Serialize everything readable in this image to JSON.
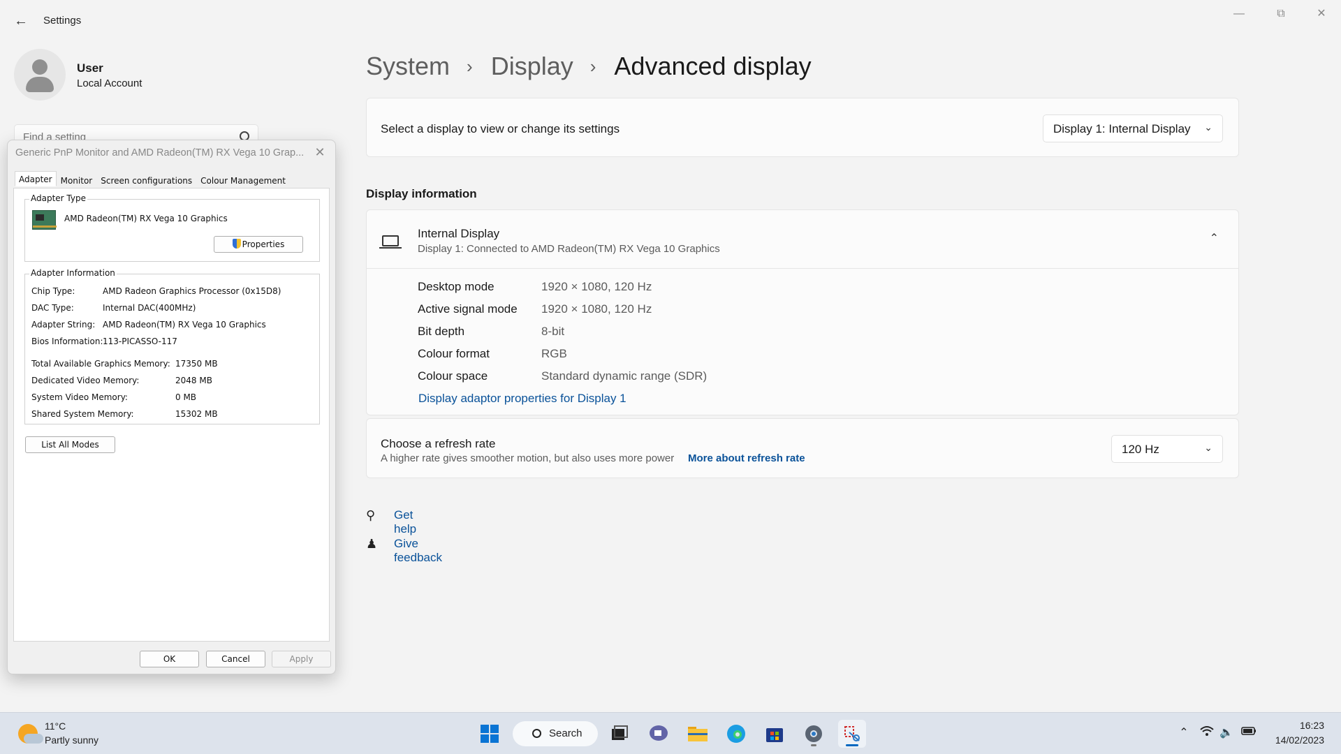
{
  "window": {
    "app_title": "Settings",
    "back_icon": "arrow-left-icon",
    "minimize_icon": "minimize-icon",
    "maximize_icon": "restore-icon",
    "close_icon": "close-icon"
  },
  "user": {
    "name": "User",
    "account_type": "Local Account"
  },
  "search": {
    "placeholder": "Find a setting"
  },
  "breadcrumb": [
    "System",
    "Display",
    "Advanced display"
  ],
  "display_select": {
    "label": "Select a display to view or change its settings",
    "selected": "Display 1: Internal Display"
  },
  "display_info": {
    "section_title": "Display information",
    "title": "Internal Display",
    "subtitle": "Display 1: Connected to AMD Radeon(TM) RX Vega 10 Graphics",
    "rows": [
      {
        "key": "Desktop mode",
        "value": "1920 × 1080, 120 Hz"
      },
      {
        "key": "Active signal mode",
        "value": "1920 × 1080, 120 Hz"
      },
      {
        "key": "Bit depth",
        "value": "8-bit"
      },
      {
        "key": "Colour format",
        "value": "RGB"
      },
      {
        "key": "Colour space",
        "value": "Standard dynamic range (SDR)"
      }
    ],
    "adaptor_link": "Display adaptor properties for Display 1"
  },
  "refresh": {
    "title": "Choose a refresh rate",
    "subtitle": "A higher rate gives smoother motion, but also uses more power",
    "more_link": "More about refresh rate",
    "selected": "120 Hz"
  },
  "help": {
    "get_help": "Get help",
    "give_feedback": "Give feedback"
  },
  "dialog": {
    "title": "Generic PnP Monitor and AMD Radeon(TM) RX Vega 10 Grap...",
    "tabs": [
      "Adapter",
      "Monitor",
      "Screen configurations",
      "Colour Management"
    ],
    "adapter_type_label": "Adapter Type",
    "adapter_name": "AMD Radeon(TM) RX Vega 10 Graphics",
    "properties_btn": "Properties",
    "adapter_info_label": "Adapter Information",
    "info": [
      {
        "key": "Chip Type:",
        "value": "AMD Radeon Graphics Processor (0x15D8)"
      },
      {
        "key": "DAC Type:",
        "value": "Internal DAC(400MHz)"
      },
      {
        "key": "Adapter String:",
        "value": "AMD Radeon(TM) RX Vega 10 Graphics"
      },
      {
        "key": "Bios Information:",
        "value": "113-PICASSO-117"
      }
    ],
    "memory": [
      {
        "key": "Total Available Graphics Memory:",
        "value": "17350 MB"
      },
      {
        "key": "Dedicated Video Memory:",
        "value": "2048 MB"
      },
      {
        "key": "System Video Memory:",
        "value": "0 MB"
      },
      {
        "key": "Shared System Memory:",
        "value": "15302 MB"
      }
    ],
    "list_modes_btn": "List All Modes",
    "ok": "OK",
    "cancel": "Cancel",
    "apply": "Apply"
  },
  "taskbar": {
    "temperature": "11°C",
    "weather": "Partly sunny",
    "search_label": "Search",
    "time": "16:23",
    "date": "14/02/2023",
    "apps": [
      "start-icon",
      "task-view-icon",
      "teams-chat-icon",
      "file-explorer-icon",
      "edge-icon",
      "store-icon",
      "settings-icon",
      "snipping-tool-icon"
    ]
  }
}
